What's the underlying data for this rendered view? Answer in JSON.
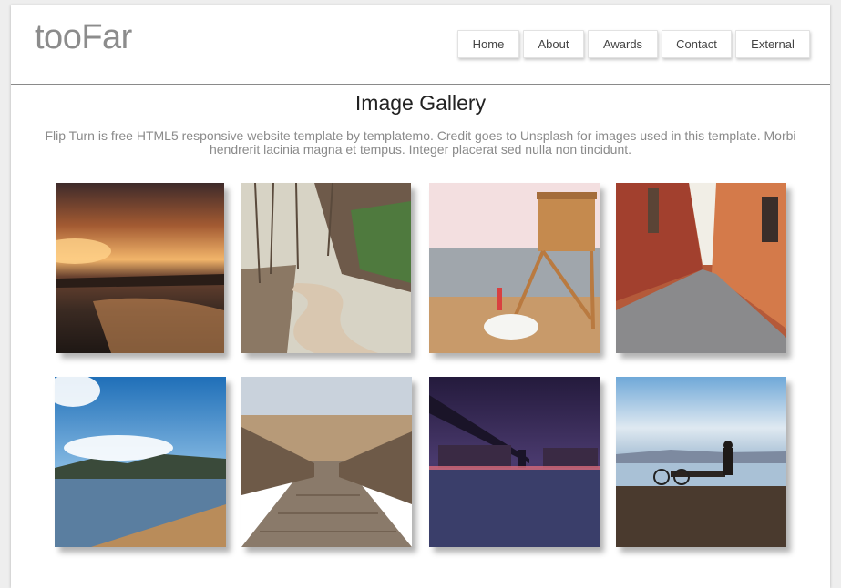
{
  "brand": {
    "logo": "tooFar"
  },
  "nav": {
    "items": [
      {
        "label": "Home"
      },
      {
        "label": "About"
      },
      {
        "label": "Awards"
      },
      {
        "label": "Contact"
      },
      {
        "label": "External"
      }
    ]
  },
  "gallery": {
    "title": "Image Gallery",
    "description": "Flip Turn is free HTML5 responsive website template by templatemo. Credit goes to Unsplash for images used in this template. Morbi hendrerit lacinia magna et tempus. Integer placerat sed nulla non tincidunt.",
    "images": [
      {
        "name": "beach-sunset-image"
      },
      {
        "name": "forest-road-image"
      },
      {
        "name": "lifeguard-tower-image"
      },
      {
        "name": "alley-street-image"
      },
      {
        "name": "mountain-lake-image"
      },
      {
        "name": "boardwalk-image"
      },
      {
        "name": "night-bridge-image"
      },
      {
        "name": "bicycle-shore-image"
      }
    ]
  },
  "colors": {
    "background": "#eeeeee",
    "logo": "#8c8c8c",
    "divider": "#8a8a8a",
    "text_muted": "#8a8a8a"
  }
}
